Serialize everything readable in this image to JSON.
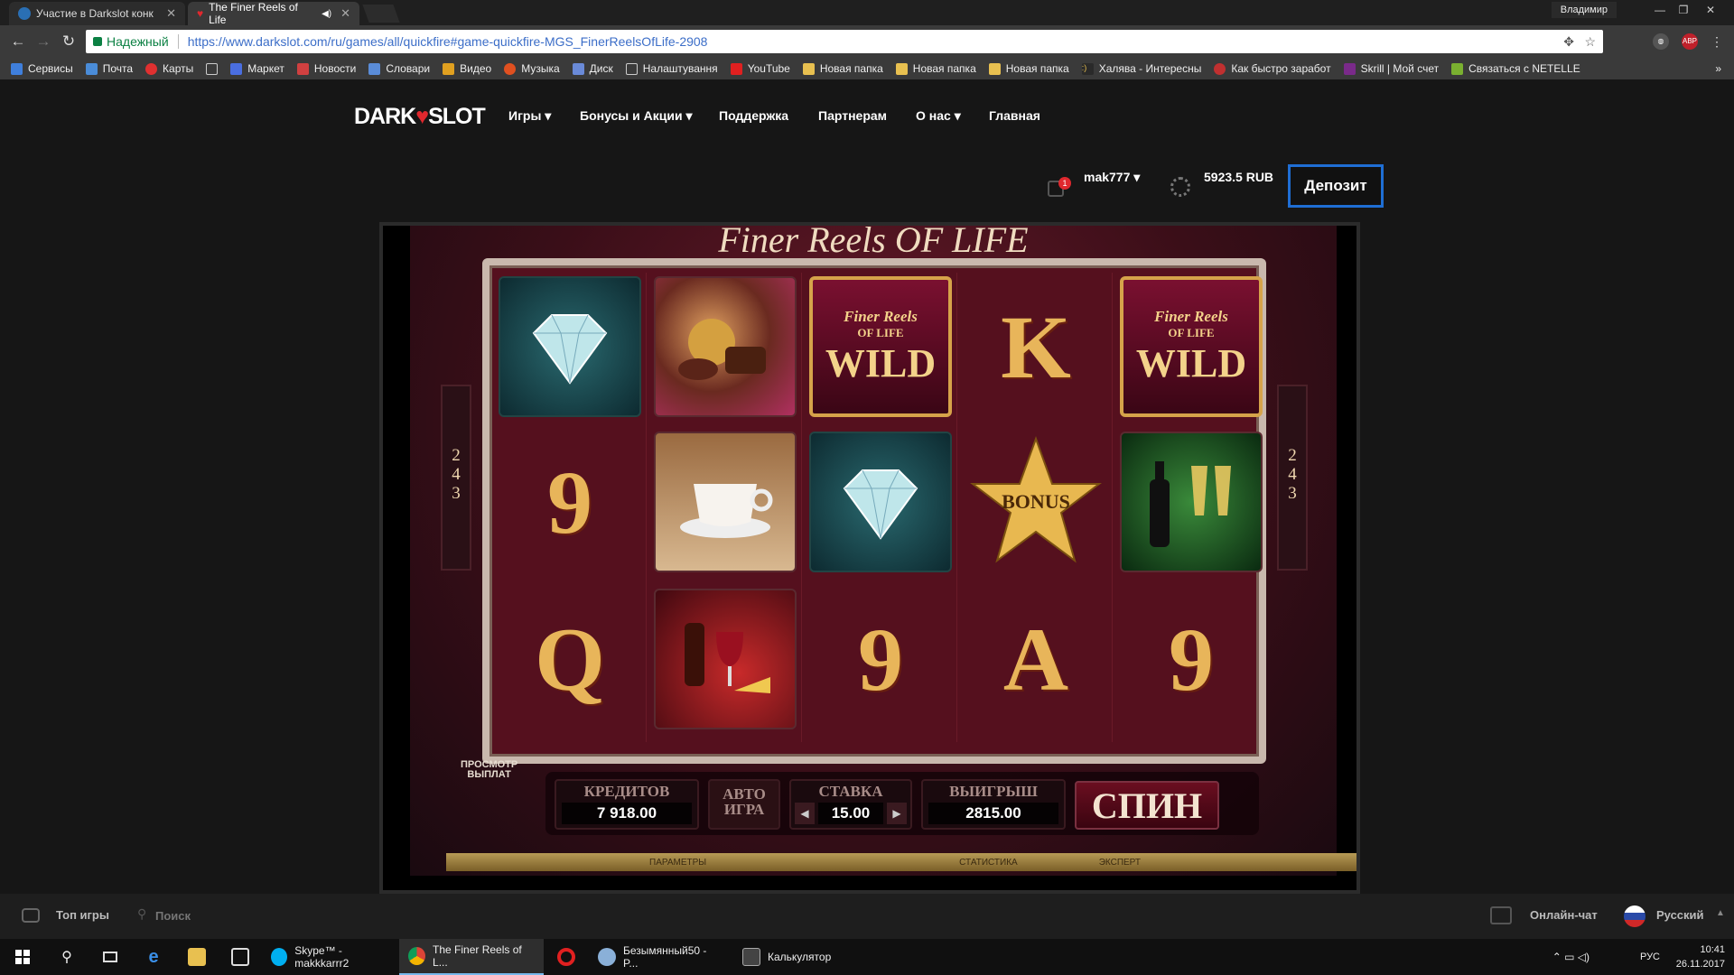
{
  "browser": {
    "tabs": [
      {
        "title": "Участие в Darkslot конк",
        "active": false
      },
      {
        "title": "The Finer Reels of Life",
        "active": true
      }
    ],
    "profile_user": "Владимир",
    "security_label": "Надежный",
    "url": "https://www.darkslot.com/ru/games/all/quickfire#game-quickfire-MGS_FinerReelsOfLife-2908",
    "bookmarks": [
      "Сервисы",
      "Почта",
      "Карты",
      "",
      "Маркет",
      "Новости",
      "Словари",
      "Видео",
      "Музыка",
      "Диск",
      "Налаштування",
      "YouTube",
      "Новая папка",
      "Новая папка",
      "Новая папка",
      "Халява - Интересны",
      "Как быстро заработ",
      "Skrill | Мой счет",
      "Связаться с NETELLE"
    ],
    "bookmarks_more": "»"
  },
  "site": {
    "logo_left": "DARK",
    "logo_heart": "♥",
    "logo_right": "SLOT",
    "nav": [
      "Игры ▾",
      "Бонусы и Акции ▾",
      "Поддержка",
      "Партнерам",
      "О нас ▾",
      "Главная"
    ],
    "notification_count": "1",
    "username": "mak777 ▾",
    "balance": "5923.5 RUB",
    "deposit_label": "Депозит"
  },
  "game": {
    "title": "Finer Reels OF LIFE",
    "ways_left": [
      "2",
      "4",
      "3"
    ],
    "ways_right": [
      "2",
      "4",
      "3"
    ],
    "wild_top": "Finer Reels",
    "wild_mid": "OF LIFE",
    "wild_label": "WILD",
    "bonus_label": "BONUS",
    "reels": [
      [
        "diamond",
        "9",
        "Q"
      ],
      [
        "chocolates",
        "coffee",
        "wine"
      ],
      [
        "wild",
        "diamond",
        "9"
      ],
      [
        "K",
        "bonus",
        "A"
      ],
      [
        "wild",
        "champagne",
        "9"
      ]
    ],
    "paytable_label_1": "ПРОСМОТР",
    "paytable_label_2": "ВЫПЛАТ",
    "credits_label": "КРЕДИТОВ",
    "credits_value": "7 918.00",
    "autoplay_label_1": "АВТО",
    "autoplay_label_2": "ИГРА",
    "bet_label": "СТАВКА",
    "bet_value": "15.00",
    "win_label": "ВЫИГРЫШ",
    "win_value": "2815.00",
    "spin_label": "СПИН",
    "bottom_links": [
      "ПАРАМЕТРЫ",
      "СТАТИСТИКА",
      "ЭКСПЕРТ"
    ]
  },
  "footer": {
    "top_games": "Топ игры",
    "search_placeholder": "Поиск",
    "live_chat": "Онлайн-чат",
    "language": "Русский"
  },
  "taskbar": {
    "items": [
      {
        "label": "Skype™ - makkkarrr2",
        "active": false
      },
      {
        "label": "The Finer Reels of L...",
        "active": true
      },
      {
        "label": "",
        "active": false
      },
      {
        "label": "Безымянный50 - P...",
        "active": false
      },
      {
        "label": "Калькулятор",
        "active": false
      }
    ],
    "lang": "РУС",
    "time": "10:41",
    "date": "26.11.2017"
  },
  "colors": {
    "accent_blue": "#1f6ed4",
    "brand_red": "#e0282e",
    "gold": "#d6a34a"
  }
}
